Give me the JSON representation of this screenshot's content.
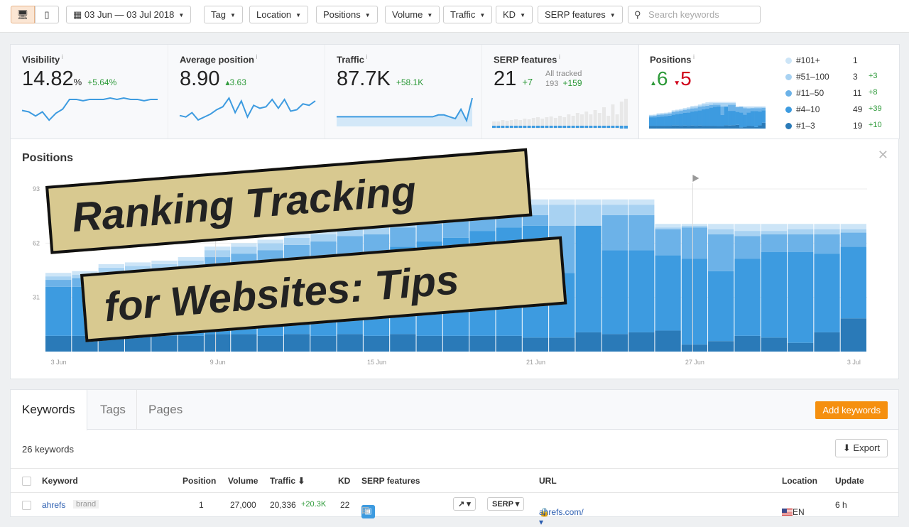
{
  "toolbar": {
    "devices": [
      {
        "icon": "desktop-icon",
        "active": true
      },
      {
        "icon": "mobile-icon",
        "active": false
      }
    ],
    "date_range": "03 Jun — 03 Jul 2018",
    "filters": [
      "Tag",
      "Location",
      "Positions",
      "Volume",
      "Traffic",
      "KD",
      "SERP features"
    ],
    "search_placeholder": "Search keywords"
  },
  "summary": {
    "visibility": {
      "title": "Visibility",
      "value": "14.82",
      "unit": "%",
      "delta": "+5.64%",
      "spark": [
        10,
        9,
        6,
        9,
        3,
        8,
        11,
        18,
        18,
        17,
        18,
        18,
        18,
        19,
        18,
        19,
        18,
        18,
        17,
        18,
        18
      ]
    },
    "avg_position": {
      "title": "Average position",
      "value": "8.90",
      "delta": "3.63",
      "spark": [
        6,
        5,
        8,
        3,
        5,
        7,
        10,
        12,
        18,
        8,
        16,
        5,
        13,
        11,
        12,
        17,
        11,
        17,
        9,
        10,
        14,
        13,
        16
      ]
    },
    "traffic": {
      "title": "Traffic",
      "value": "87.7K",
      "delta": "+58.1K",
      "spark": [
        4,
        4,
        4,
        4,
        4,
        4,
        4,
        4,
        4,
        4,
        4,
        4,
        4,
        4,
        4,
        4,
        4,
        4,
        5,
        5,
        4,
        3,
        8,
        2,
        14
      ]
    },
    "serp": {
      "title": "SERP features",
      "value": "21",
      "delta": "+7",
      "all_tracked_label": "All tracked",
      "all_tracked": "193",
      "all_tracked_delta": "+159"
    },
    "positions": {
      "title": "Positions",
      "up": "6",
      "down": "5",
      "legend": [
        {
          "label": "#101+",
          "count": "1",
          "delta": "",
          "color": "#cde5f7"
        },
        {
          "label": "#51–100",
          "count": "3",
          "delta": "+3",
          "color": "#a8d2f2"
        },
        {
          "label": "#11–50",
          "count": "11",
          "delta": "+8",
          "color": "#6cb2e8"
        },
        {
          "label": "#4–10",
          "count": "49",
          "delta": "+39",
          "color": "#3d9be0"
        },
        {
          "label": "#1–3",
          "count": "19",
          "delta": "+10",
          "color": "#2a7ab8"
        }
      ]
    }
  },
  "chart_data": {
    "type": "bar",
    "stacked": true,
    "title": "Positions",
    "ylim": [
      0,
      93
    ],
    "yticks": [
      "31",
      "62",
      "93"
    ],
    "xtick_labels": [
      "3 Jun",
      "9 Jun",
      "15 Jun",
      "21 Jun",
      "27 Jun",
      "3 Jul"
    ],
    "annotations": [
      "9 Jun",
      "27 Jun"
    ],
    "series_colors": [
      "#2a7ab8",
      "#3d9be0",
      "#6cb2e8",
      "#a8d2f2",
      "#cde5f7"
    ],
    "series": [
      {
        "name": "#1–3"
      },
      {
        "name": "#4–10"
      },
      {
        "name": "#11–50"
      },
      {
        "name": "#51–100"
      },
      {
        "name": "#101+"
      }
    ],
    "categories": [
      "3 Jun",
      "4 Jun",
      "5 Jun",
      "6 Jun",
      "7 Jun",
      "8 Jun",
      "9 Jun",
      "10 Jun",
      "11 Jun",
      "12 Jun",
      "13 Jun",
      "14 Jun",
      "15 Jun",
      "16 Jun",
      "17 Jun",
      "18 Jun",
      "19 Jun",
      "20 Jun",
      "21 Jun",
      "22 Jun",
      "23 Jun",
      "24 Jun",
      "25 Jun",
      "26 Jun",
      "27 Jun",
      "28 Jun",
      "29 Jun",
      "30 Jun",
      "1 Jul",
      "2 Jul",
      "3 Jul"
    ],
    "values": [
      [
        9,
        28,
        4,
        2,
        2
      ],
      [
        9,
        28,
        5,
        2,
        2
      ],
      [
        9,
        30,
        6,
        3,
        2
      ],
      [
        9,
        31,
        6,
        3,
        2
      ],
      [
        9,
        32,
        6,
        3,
        2
      ],
      [
        9,
        33,
        7,
        3,
        2
      ],
      [
        10,
        36,
        8,
        4,
        2
      ],
      [
        10,
        38,
        8,
        4,
        2
      ],
      [
        9,
        40,
        9,
        4,
        2
      ],
      [
        10,
        42,
        9,
        4,
        2
      ],
      [
        9,
        44,
        10,
        4,
        3
      ],
      [
        10,
        46,
        10,
        5,
        3
      ],
      [
        9,
        48,
        10,
        5,
        3
      ],
      [
        10,
        50,
        11,
        5,
        3
      ],
      [
        9,
        54,
        10,
        6,
        4
      ],
      [
        9,
        56,
        10,
        6,
        5
      ],
      [
        9,
        60,
        8,
        6,
        4
      ],
      [
        9,
        62,
        7,
        6,
        3
      ],
      [
        8,
        64,
        6,
        6,
        3
      ],
      [
        8,
        37,
        27,
        12,
        3
      ],
      [
        11,
        61,
        0,
        12,
        3
      ],
      [
        10,
        48,
        20,
        6,
        3
      ],
      [
        11,
        47,
        20,
        6,
        3
      ],
      [
        12,
        43,
        15,
        1,
        2
      ],
      [
        4,
        49,
        18,
        1,
        1
      ],
      [
        6,
        40,
        21,
        3,
        3
      ],
      [
        9,
        44,
        13,
        3,
        4
      ],
      [
        8,
        49,
        10,
        2,
        4
      ],
      [
        5,
        52,
        10,
        3,
        3
      ],
      [
        11,
        45,
        11,
        3,
        3
      ],
      [
        19,
        41,
        8,
        2,
        3
      ]
    ]
  },
  "overlay": {
    "line1": "Ranking Tracking",
    "line2": "for Websites: Tips"
  },
  "keywords": {
    "tabs": [
      "Keywords",
      "Tags",
      "Pages"
    ],
    "add_label": "Add keywords",
    "count": "26 keywords",
    "export_label": "Export",
    "columns": [
      "Keyword",
      "Position",
      "Volume",
      "Traffic ⬇",
      "KD",
      "SERP features",
      "URL",
      "Location",
      "Update"
    ],
    "rows": [
      {
        "keyword": "ahrefs",
        "badge": "brand",
        "position": "1",
        "volume": "27,000",
        "traffic": "20,336",
        "traffic_delta": "+20.3K",
        "kd": "22",
        "serp_btn": "SERP ▾",
        "url": "ahrefs.com/ ▾",
        "location": "EN",
        "update": "6 h"
      }
    ]
  }
}
